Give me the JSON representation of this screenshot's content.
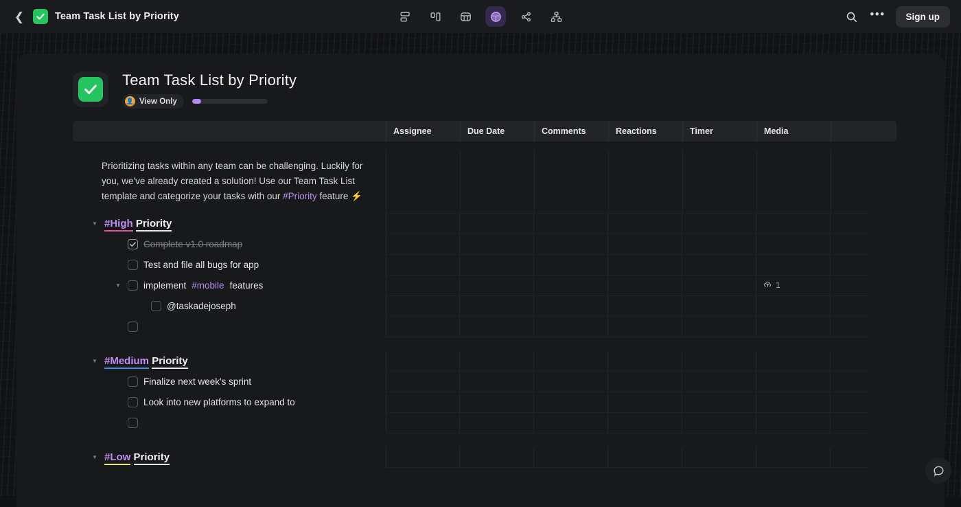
{
  "topbar": {
    "back_icon": "chevron-left-icon",
    "favicon": "green-check-icon",
    "title": "Team Task List by Priority",
    "view_icons": [
      {
        "name": "list-view-icon",
        "active": false
      },
      {
        "name": "board-view-icon",
        "active": false
      },
      {
        "name": "table-view-icon",
        "active": false
      },
      {
        "name": "calendar-view-icon",
        "active": true
      },
      {
        "name": "mindmap-view-icon",
        "active": false
      },
      {
        "name": "org-chart-view-icon",
        "active": false
      }
    ],
    "search_icon": "search-icon",
    "more_icon": "more-horizontal-icon",
    "more_label": "•••",
    "signup_label": "Sign up"
  },
  "document": {
    "icon": "green-check-icon",
    "title": "Team Task List by Priority",
    "view_only_label": "View Only",
    "view_only_avatar": "user-avatar-emoji",
    "progress_percent": 12,
    "more_icon": "more-horizontal-icon",
    "more_label": "•••"
  },
  "table": {
    "columns": [
      "Assignee",
      "Due Date",
      "Comments",
      "Reactions",
      "Timer",
      "Media"
    ],
    "intro": {
      "part1": "Prioritizing tasks within any team can be challenging. Luckily for you, we've already created a solution! Use our Team Task List template and categorize your tasks with our ",
      "tag": "#Priority",
      "part2": " feature ⚡"
    },
    "sections": [
      {
        "tag": "#High",
        "tag_color": "#ef4aa0",
        "word": "Priority",
        "tag_class": "tag-high",
        "rows": [
          {
            "text": "Complete v1.0 roadmap",
            "checked": true,
            "done": true,
            "indent": 1,
            "caret": false,
            "media": ""
          },
          {
            "text": "Test and file all bugs for app",
            "checked": false,
            "done": false,
            "indent": 1,
            "caret": false,
            "media": ""
          },
          {
            "text": "implement #mobile features",
            "checked": false,
            "done": false,
            "indent": 1,
            "caret": true,
            "media": "1",
            "tag": "#mobile"
          },
          {
            "text": "@taskadejoseph",
            "checked": false,
            "done": false,
            "indent": 2,
            "caret": false,
            "media": ""
          },
          {
            "text": "",
            "checked": false,
            "done": false,
            "indent": 1,
            "caret": false,
            "media": ""
          }
        ]
      },
      {
        "tag": "#Medium",
        "tag_color": "#4a8fe8",
        "word": "Priority",
        "tag_class": "tag-medium",
        "rows": [
          {
            "text": "Finalize next week's sprint",
            "checked": false,
            "done": false,
            "indent": 1,
            "caret": false,
            "media": ""
          },
          {
            "text": "Look into new platforms to expand to",
            "checked": false,
            "done": false,
            "indent": 1,
            "caret": false,
            "media": ""
          },
          {
            "text": "",
            "checked": false,
            "done": false,
            "indent": 1,
            "caret": false,
            "media": ""
          }
        ]
      },
      {
        "tag": "#Low",
        "tag_color": "#eeea63",
        "word": "Priority",
        "tag_class": "tag-low",
        "rows": []
      }
    ]
  },
  "chat_fab": {
    "icon": "chat-bubble-icon"
  }
}
